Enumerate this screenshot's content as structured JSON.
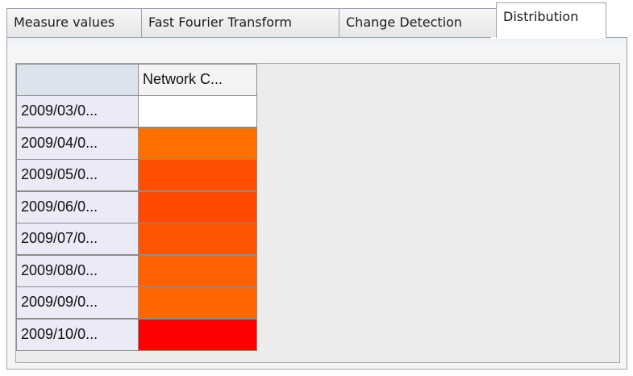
{
  "tabs": [
    {
      "label": "Measure values",
      "active": false
    },
    {
      "label": "Fast Fourier Transform",
      "active": false
    },
    {
      "label": "Change Detection",
      "active": false
    },
    {
      "label": "Distribution",
      "active": true
    }
  ],
  "table": {
    "column_header": "Network C...",
    "rows": [
      {
        "label": "2009/03/0...",
        "color": "#ffffff"
      },
      {
        "label": "2009/04/0...",
        "color": "#ff7000"
      },
      {
        "label": "2009/05/0...",
        "color": "#ff4f00"
      },
      {
        "label": "2009/06/0...",
        "color": "#ff4a00"
      },
      {
        "label": "2009/07/0...",
        "color": "#ff5400"
      },
      {
        "label": "2009/08/0...",
        "color": "#ff6000"
      },
      {
        "label": "2009/09/0...",
        "color": "#ff6500"
      },
      {
        "label": "2009/10/0...",
        "color": "#ff0000"
      }
    ]
  }
}
